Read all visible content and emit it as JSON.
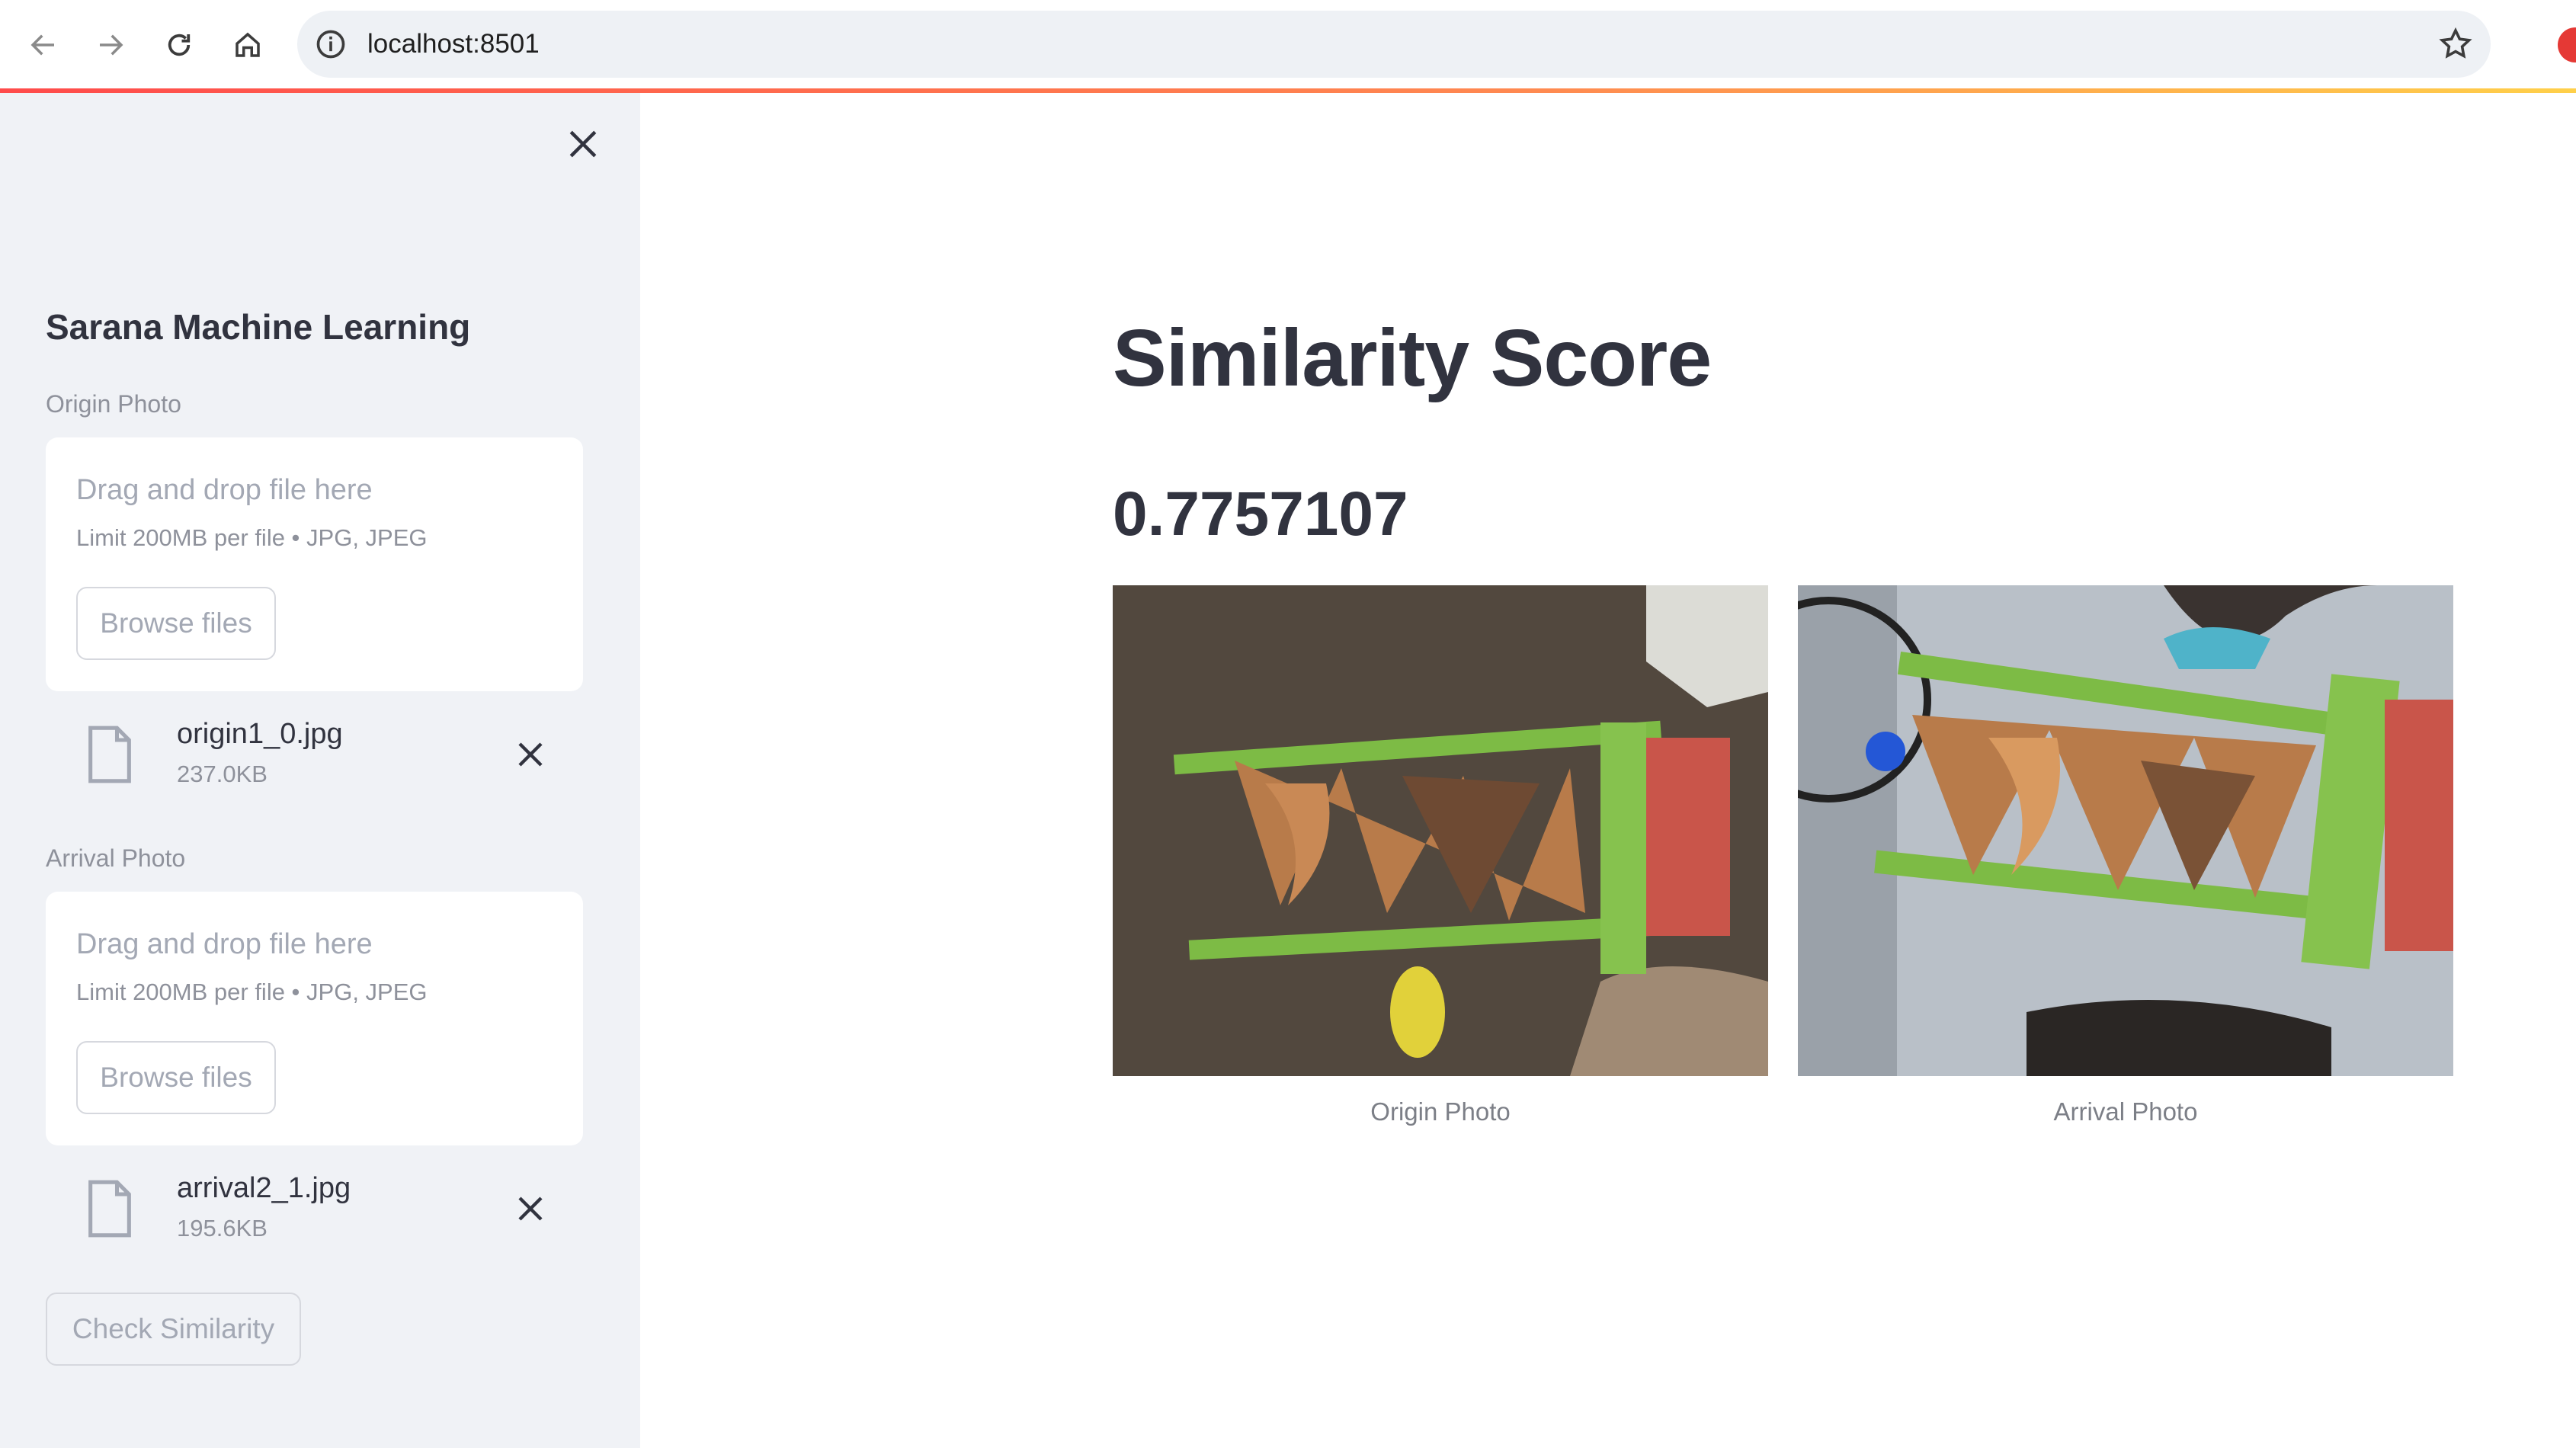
{
  "browser": {
    "url": "localhost:8501",
    "icons": [
      "back-arrow-icon",
      "forward-arrow-icon",
      "reload-icon",
      "home-icon",
      "info-icon",
      "star-icon",
      "extension-icon"
    ]
  },
  "sidebar": {
    "title": "Sarana Machine Learning",
    "origin": {
      "label": "Origin Photo",
      "drop_text": "Drag and drop file here",
      "limit_text": "Limit 200MB per file • JPG, JPEG",
      "browse_label": "Browse files",
      "file_name": "origin1_0.jpg",
      "file_size": "237.0KB"
    },
    "arrival": {
      "label": "Arrival Photo",
      "drop_text": "Drag and drop file here",
      "limit_text": "Limit 200MB per file • JPG, JPEG",
      "browse_label": "Browse files",
      "file_name": "arrival2_1.jpg",
      "file_size": "195.6KB"
    },
    "check_button": "Check Similarity"
  },
  "main": {
    "title": "Similarity Score",
    "score": "0.7757107",
    "images": [
      {
        "caption": "Origin Photo"
      },
      {
        "caption": "Arrival Photo"
      }
    ]
  },
  "colors": {
    "sidebar_bg": "#f0f2f6",
    "text": "#31333f",
    "muted": "#8e919b",
    "accent_gradient_start": "#ff4b4b",
    "accent_gradient_end": "#ffd04a"
  }
}
